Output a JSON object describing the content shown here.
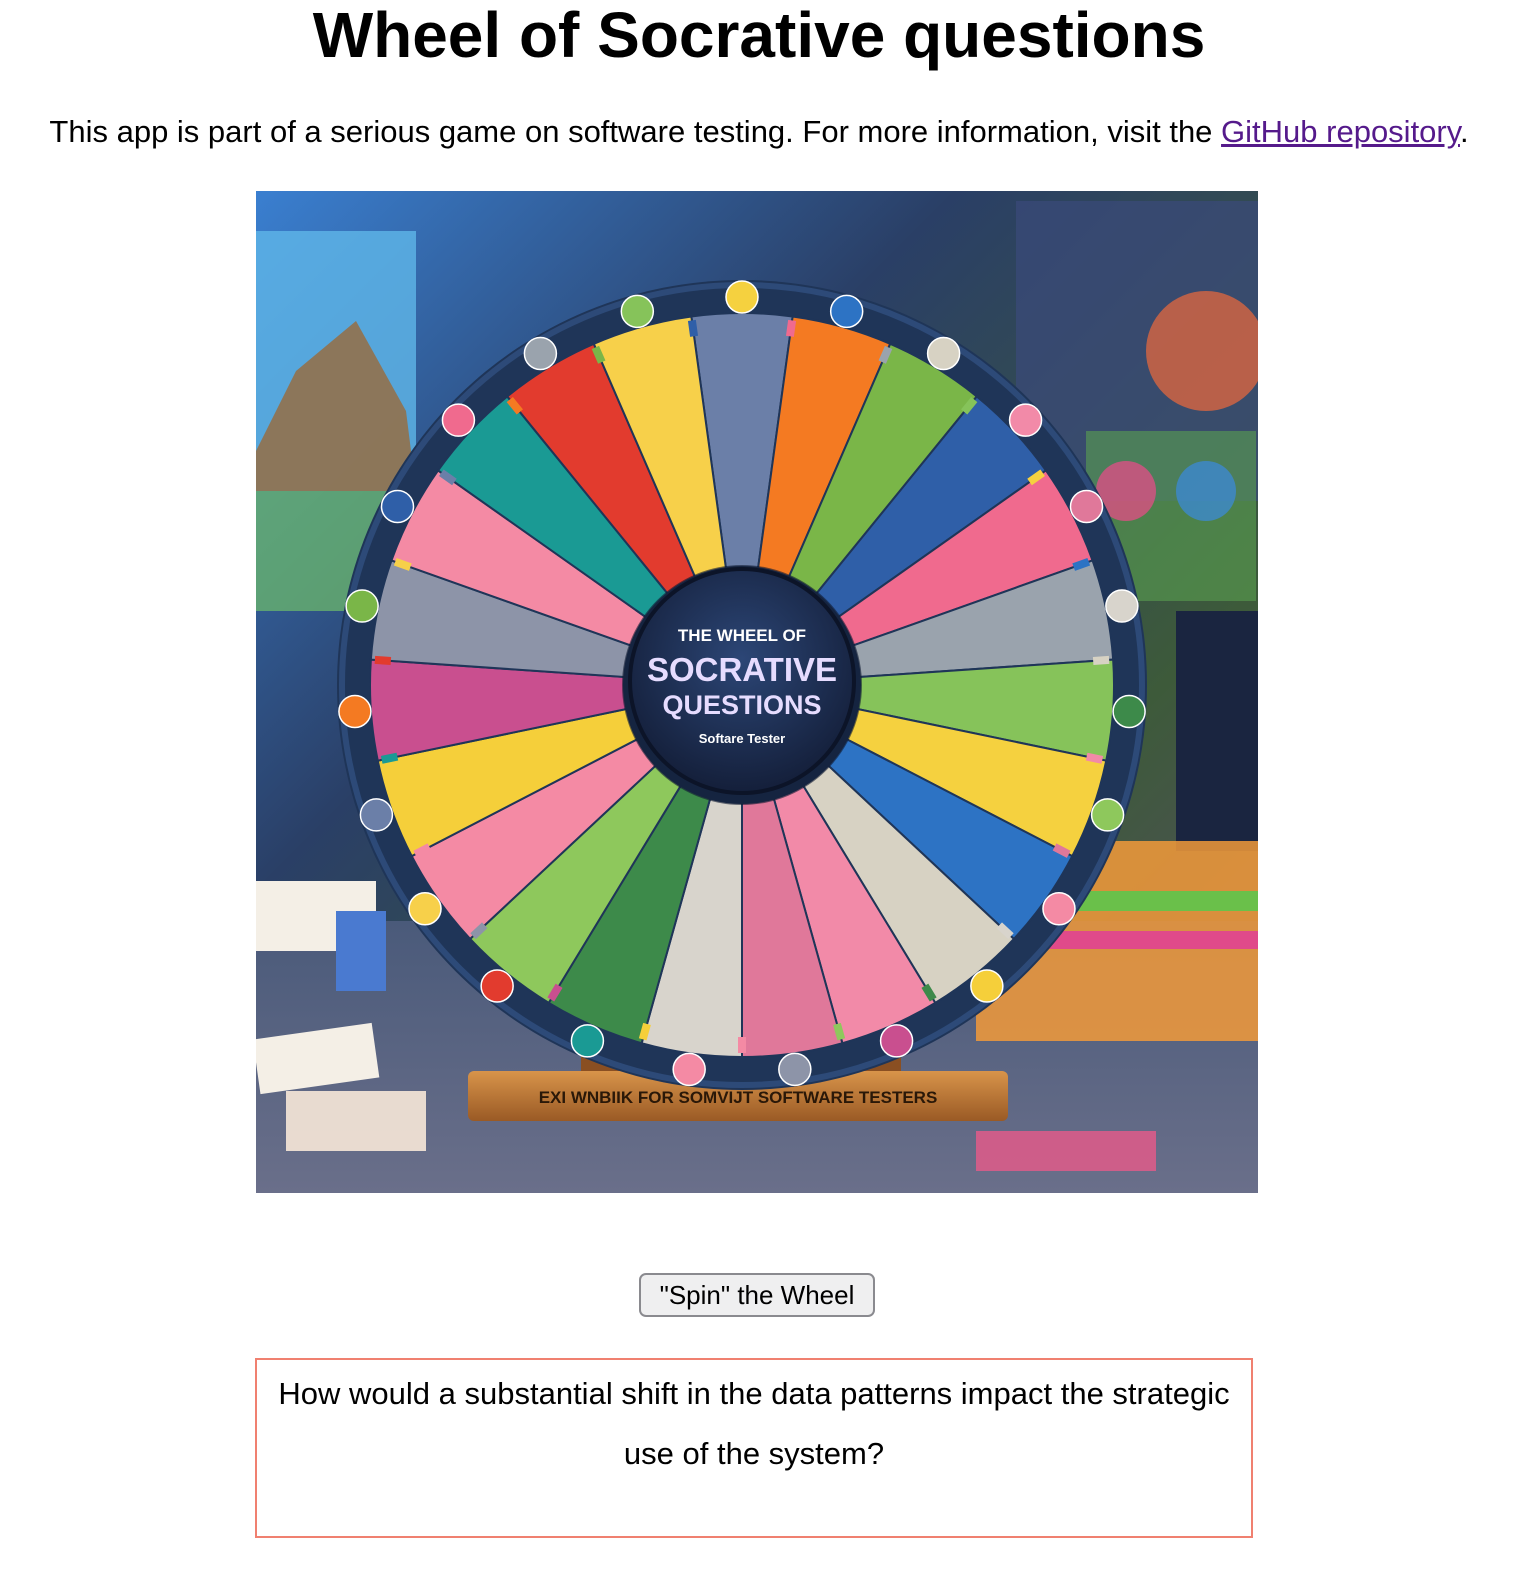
{
  "page": {
    "title": "Wheel of Socrative questions"
  },
  "intro": {
    "text_before_link": "This app is part of a serious game on software testing. For more information, visit the ",
    "link_text": "GitHub repository",
    "text_after_link": "."
  },
  "wheel": {
    "center_line1": "THE WHEEL OF",
    "center_line2": "SOCRATIVE",
    "center_line3": "QUESTIONS",
    "center_line4": "Softare Tester",
    "stand_text": "EXI WNBIIK FOR SOMVIJT SOFTWARE TESTERS",
    "segment_colors": [
      "#6b7fa8",
      "#f47a22",
      "#7ab648",
      "#2f5fa8",
      "#f06a8e",
      "#9aa3ad",
      "#86c35a",
      "#f5d13f",
      "#2d73c4",
      "#d7d2c3",
      "#f28aa8",
      "#e0789a",
      "#d8d4cc",
      "#3d8a4a",
      "#8ec85c",
      "#f48aa4",
      "#f5cf3a",
      "#c94f8f",
      "#8d94a8",
      "#f48aa4",
      "#1a9a94",
      "#e23b2e",
      "#f7d04a"
    ],
    "rim_color": "#1f3558",
    "hub_color": "#1b2b4d"
  },
  "controls": {
    "spin_label": "\"Spin\" the Wheel"
  },
  "question": {
    "text": "How would a substantial shift in the data patterns impact the strategic use of the system?"
  },
  "colors": {
    "link": "#551a8b",
    "question_border": "#f08070"
  }
}
